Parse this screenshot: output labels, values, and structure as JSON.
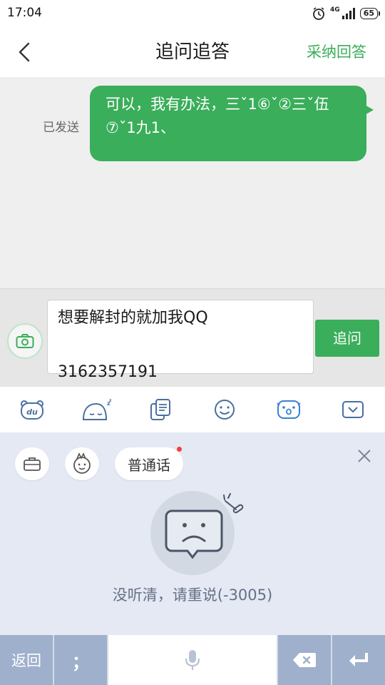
{
  "status_bar": {
    "time": "17:04",
    "network": "4G",
    "battery": "65"
  },
  "header": {
    "title": "追问追答",
    "accept_label": "采纳回答"
  },
  "chat": {
    "sent_status": "已发送",
    "message": "可以，我有办法，三ˇ1⑥ˇ②三ˇ伍⑦ˇ1九1、"
  },
  "composer": {
    "input_value": "想要解封的就加我QQ\n\n3162357191",
    "send_label": "追问"
  },
  "voice_panel": {
    "dialect_label": "普通话",
    "error_text": "没听清，请重说(-3005)"
  },
  "keyboard": {
    "back_label": "返回",
    "semicolon_label": "；"
  },
  "colors": {
    "accent": "#3aae5a",
    "panel_bg": "#e4e9f3",
    "key_bg": "#9fb0cc"
  }
}
